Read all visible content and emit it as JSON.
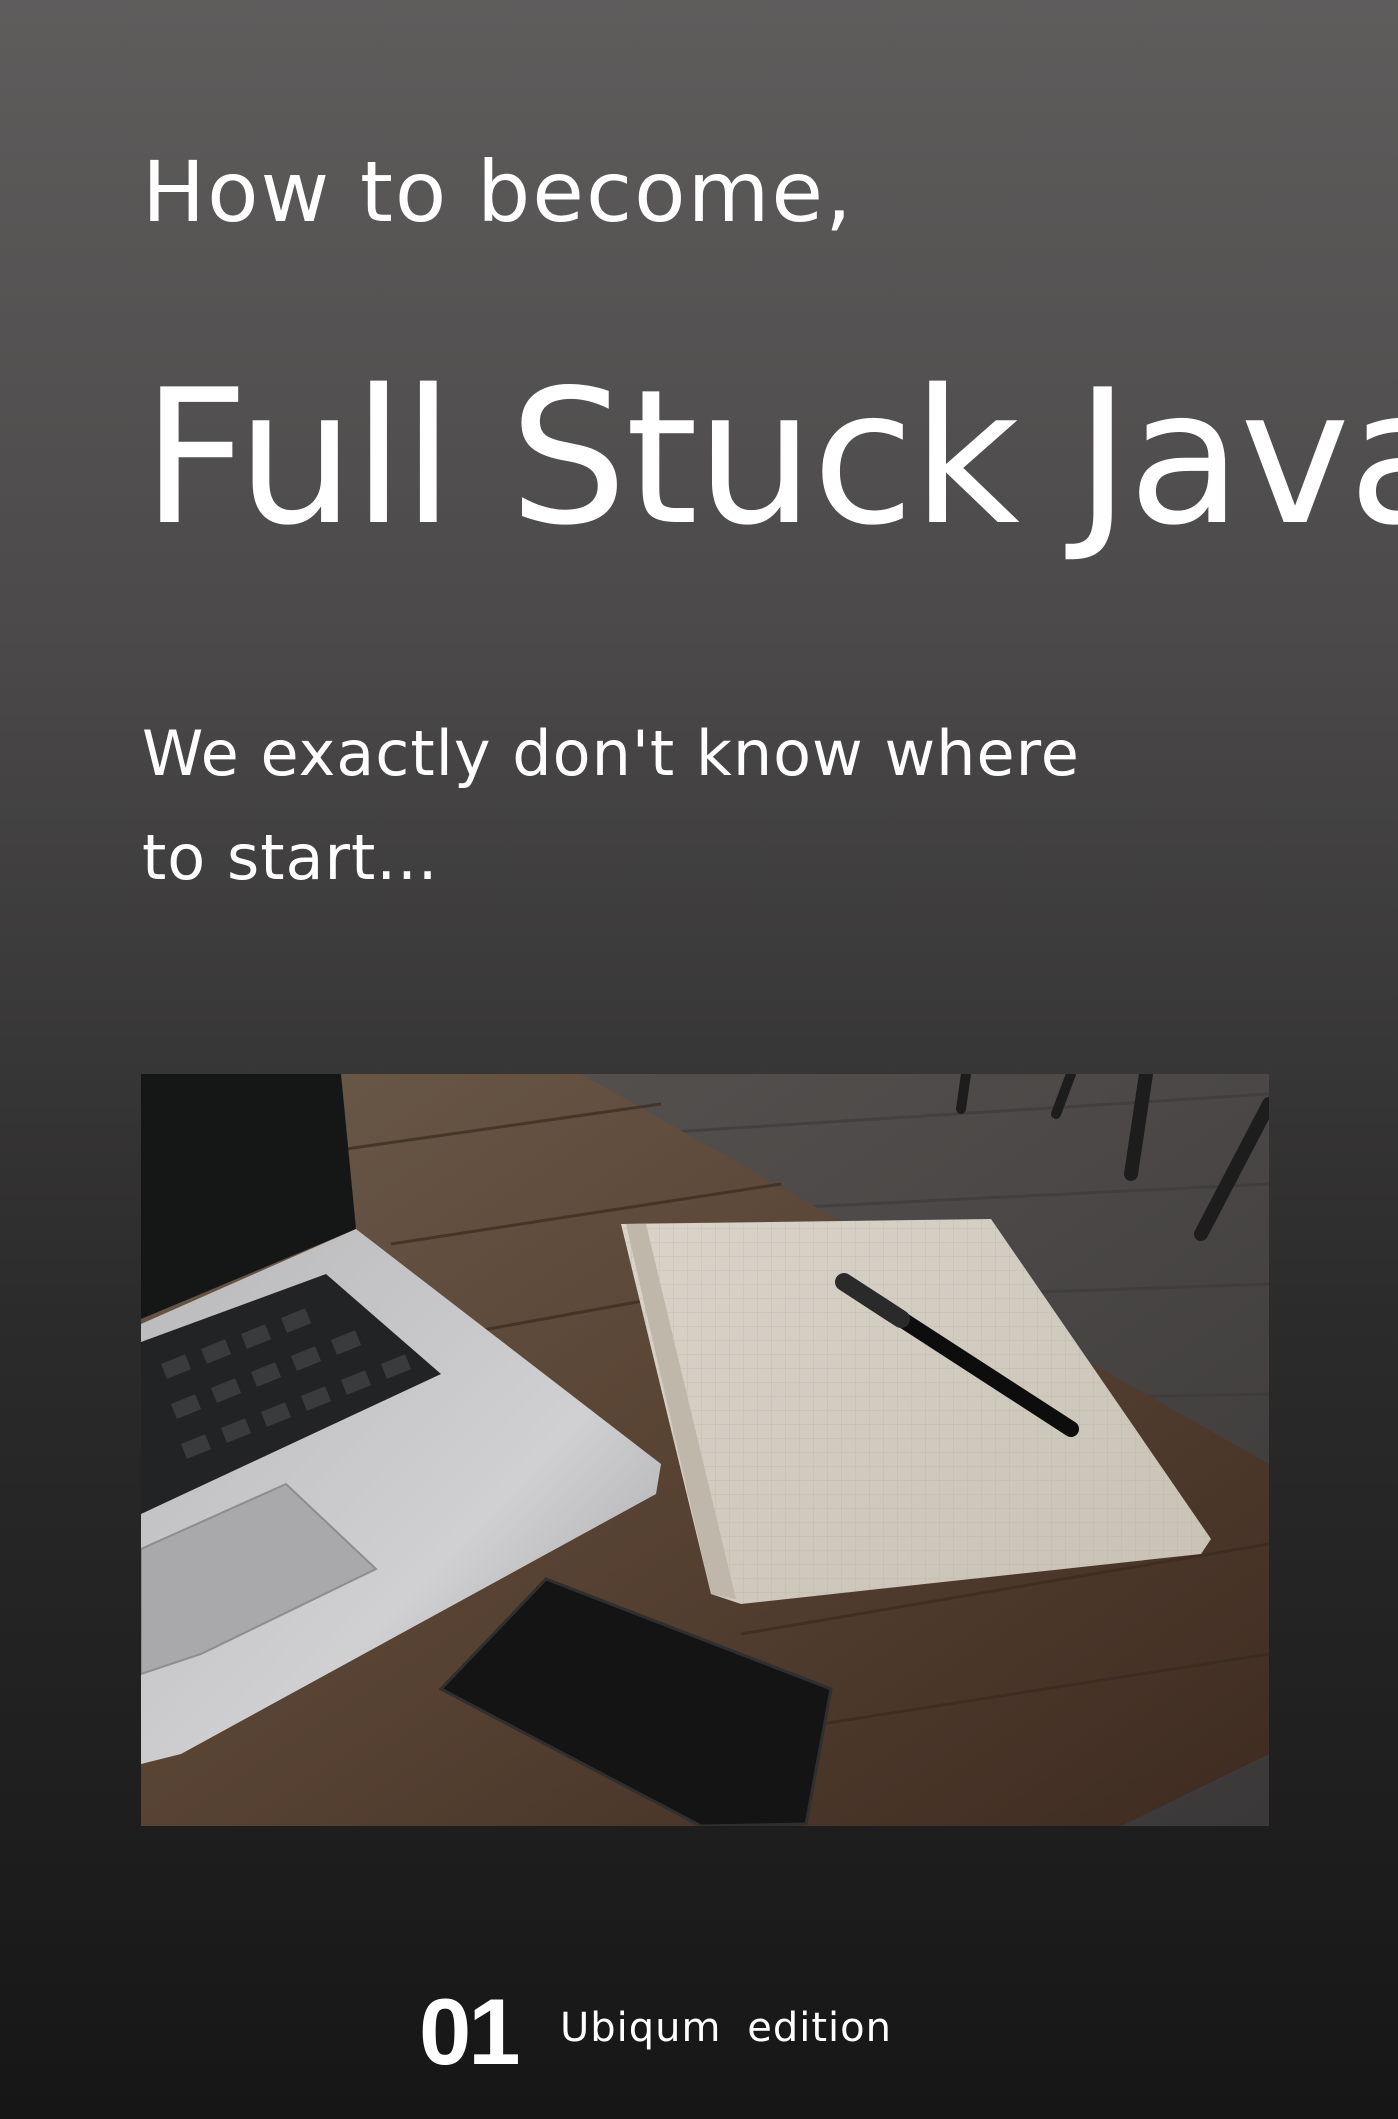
{
  "cover": {
    "subtitle_top": "How to become,",
    "title": "Full Stuck Java",
    "tagline_line1": "We exactly don't know where",
    "tagline_line2": "to start...",
    "edition_number": "01",
    "edition_label": "Ubiqum  edition"
  },
  "photo": {
    "description_icon": "laptop-notebook-pen-phone-photo"
  },
  "colors": {
    "background_top": "#5f5c5c",
    "background_bottom": "#161616",
    "text": "#ffffff"
  }
}
